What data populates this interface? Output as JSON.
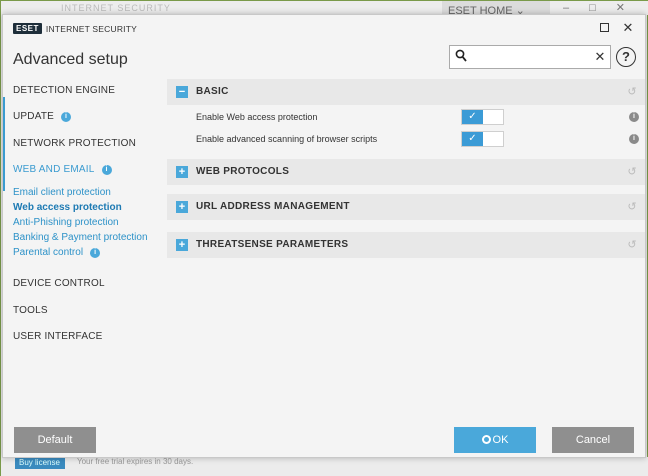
{
  "background": {
    "title_ghost": "INTERNET SECURITY",
    "home_tab": "ESET HOME",
    "buy_label": "Buy license",
    "trial_text": "Your free trial expires in 30 days."
  },
  "dialog": {
    "logo_brand": "ESET",
    "logo_product": "INTERNET SECURITY",
    "title": "Advanced setup",
    "search": {
      "value": "",
      "placeholder": ""
    }
  },
  "sidebar": {
    "items": [
      {
        "label": "DETECTION ENGINE",
        "badge": false
      },
      {
        "label": "UPDATE",
        "badge": true
      },
      {
        "label": "NETWORK PROTECTION",
        "badge": false
      },
      {
        "label": "WEB AND EMAIL",
        "badge": true
      },
      {
        "label": "DEVICE CONTROL",
        "badge": false
      },
      {
        "label": "TOOLS",
        "badge": false
      },
      {
        "label": "USER INTERFACE",
        "badge": false
      }
    ],
    "sub_items": [
      {
        "label": "Email client protection",
        "badge": false
      },
      {
        "label": "Web access protection",
        "badge": false,
        "selected": true
      },
      {
        "label": "Anti-Phishing protection",
        "badge": false
      },
      {
        "label": "Banking & Payment protection",
        "badge": false
      },
      {
        "label": "Parental control",
        "badge": true
      }
    ]
  },
  "sections": [
    {
      "title": "BASIC",
      "expanded": true,
      "settings": [
        {
          "label": "Enable Web access protection",
          "enabled": true
        },
        {
          "label": "Enable advanced scanning of browser scripts",
          "enabled": true
        }
      ]
    },
    {
      "title": "WEB PROTOCOLS",
      "expanded": false
    },
    {
      "title": "URL ADDRESS MANAGEMENT",
      "expanded": false
    },
    {
      "title": "THREATSENSE PARAMETERS",
      "expanded": false
    }
  ],
  "buttons": {
    "default": "Default",
    "ok": "OK",
    "cancel": "Cancel"
  },
  "colors": {
    "accent": "#4aa8da",
    "button_gray": "#8f8f8f",
    "section_bg": "#e8e8e8"
  }
}
